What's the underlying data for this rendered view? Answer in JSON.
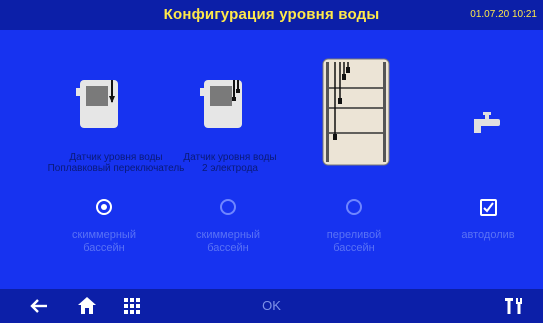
{
  "header": {
    "title": "Конфигурация уровня воды",
    "datetime": "01.07.20 10:21"
  },
  "options": [
    {
      "label_line1": "Датчик уровня воды",
      "label_line2": "Поплавковый переключатель",
      "icon": "float-switch-sensor-icon"
    },
    {
      "label_line1": "Датчик уровня воды",
      "label_line2": "2 электрода",
      "icon": "two-electrode-sensor-icon"
    },
    {
      "icon": "multi-electrode-tank-icon"
    },
    {
      "icon": "water-tap-icon"
    }
  ],
  "choices": [
    {
      "line1": "скиммерный",
      "line2": "бассейн",
      "selected": true
    },
    {
      "line1": "скиммерный",
      "line2": "бассейн",
      "selected": false
    },
    {
      "line1": "переливой",
      "line2": "бассейн",
      "selected": false
    },
    {
      "line1": "автодолив",
      "line2": "",
      "checked": true
    }
  ],
  "footer": {
    "ok_label": "OK",
    "icons": [
      "back-arrow-icon",
      "home-icon",
      "grid-menu-icon",
      "tools-icon"
    ]
  },
  "colors": {
    "background": "#1733f0",
    "bar": "#0c1fa8",
    "title": "#ffe94a"
  }
}
